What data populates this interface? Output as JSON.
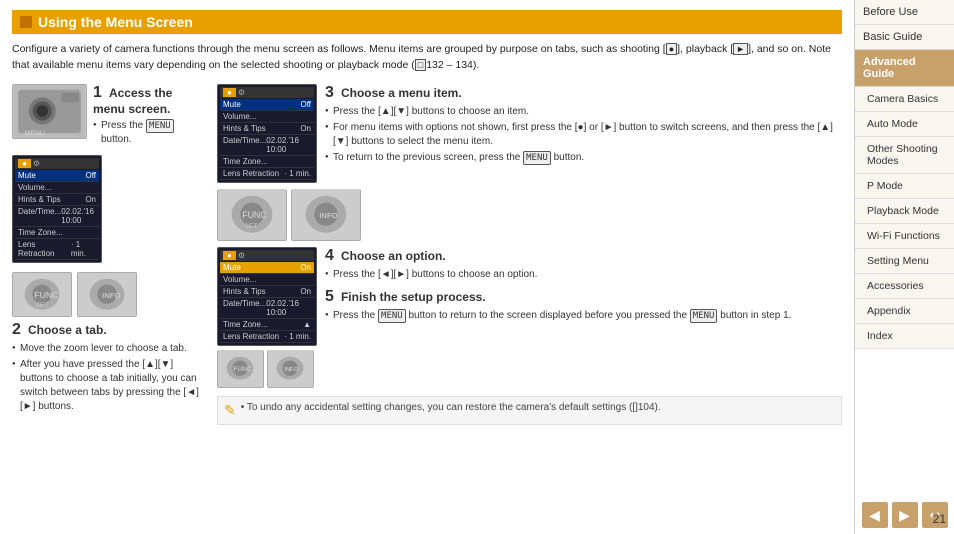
{
  "title": "Using the Menu Screen",
  "intro": "Configure a variety of camera functions through the menu screen as follows. Menu items are grouped by purpose on tabs, such as shooting [camera], playback [play], and so on. Note that available menu items vary depending on the selected shooting or playback mode ([]132 – 134).",
  "steps": [
    {
      "number": "1",
      "title": "Access the menu screen.",
      "bullets": [
        "Press the [MENU] button."
      ]
    },
    {
      "number": "2",
      "title": "Choose a tab.",
      "bullets": [
        "Move the zoom lever to choose a tab.",
        "After you have pressed the [▲][▼] buttons to choose a tab initially, you can switch between tabs by pressing the [◄][►] buttons."
      ]
    },
    {
      "number": "3",
      "title": "Choose a menu item.",
      "bullets": [
        "Press the [▲][▼] buttons to choose an item.",
        "For menu items with options not shown, first press the [●] or [►] button to switch screens, and then press the [▲][▼] buttons to select the menu item.",
        "To return to the previous screen, press the [MENU] button."
      ]
    },
    {
      "number": "4",
      "title": "Choose an option.",
      "bullets": [
        "Press the [◄][►] buttons to choose an option."
      ]
    },
    {
      "number": "5",
      "title": "Finish the setup process.",
      "bullets": [
        "Press the [MENU] button to return to the screen displayed before you pressed the [MENU] button in step 1."
      ]
    }
  ],
  "note": "• To undo any accidental setting changes, you can restore the camera's default settings ([]104).",
  "sidebar": {
    "items": [
      {
        "label": "Before Use",
        "active": false
      },
      {
        "label": "Basic Guide",
        "active": false
      },
      {
        "label": "Advanced Guide",
        "active": true
      },
      {
        "label": "Camera Basics",
        "active": false
      },
      {
        "label": "Auto Mode",
        "active": false
      },
      {
        "label": "Other Shooting Modes",
        "active": false
      },
      {
        "label": "P Mode",
        "active": false
      },
      {
        "label": "Playback Mode",
        "active": false
      },
      {
        "label": "Wi-Fi Functions",
        "active": false
      },
      {
        "label": "Setting Menu",
        "active": false
      },
      {
        "label": "Accessories",
        "active": false
      },
      {
        "label": "Appendix",
        "active": false
      },
      {
        "label": "Index",
        "active": false
      }
    ]
  },
  "menu_screen_1": {
    "tab": "camera",
    "tab2": "settings",
    "rows": [
      {
        "label": "Mute",
        "value": "Off",
        "highlighted": true
      },
      {
        "label": "Volume...",
        "value": ""
      },
      {
        "label": "Hints & Tips",
        "value": "On"
      },
      {
        "label": "Date/Time...",
        "value": "02.02.'16 10:00"
      },
      {
        "label": "Time Zone...",
        "value": ""
      },
      {
        "label": "Lens Retraction",
        "value": "· 1 min."
      }
    ]
  },
  "menu_screen_2": {
    "rows": [
      {
        "label": "Mute",
        "value": "On",
        "highlighted": true,
        "orange": true
      },
      {
        "label": "Volume...",
        "value": ""
      },
      {
        "label": "Hints & Tips",
        "value": "On"
      },
      {
        "label": "Date/Time...",
        "value": "02.02.'16 10:00"
      },
      {
        "label": "Time Zone...",
        "value": "▲"
      },
      {
        "label": "Lens Retraction",
        "value": "· 1 min."
      }
    ]
  },
  "page_number": "21",
  "nav": {
    "prev": "◀",
    "next": "▶",
    "home": "↩"
  }
}
